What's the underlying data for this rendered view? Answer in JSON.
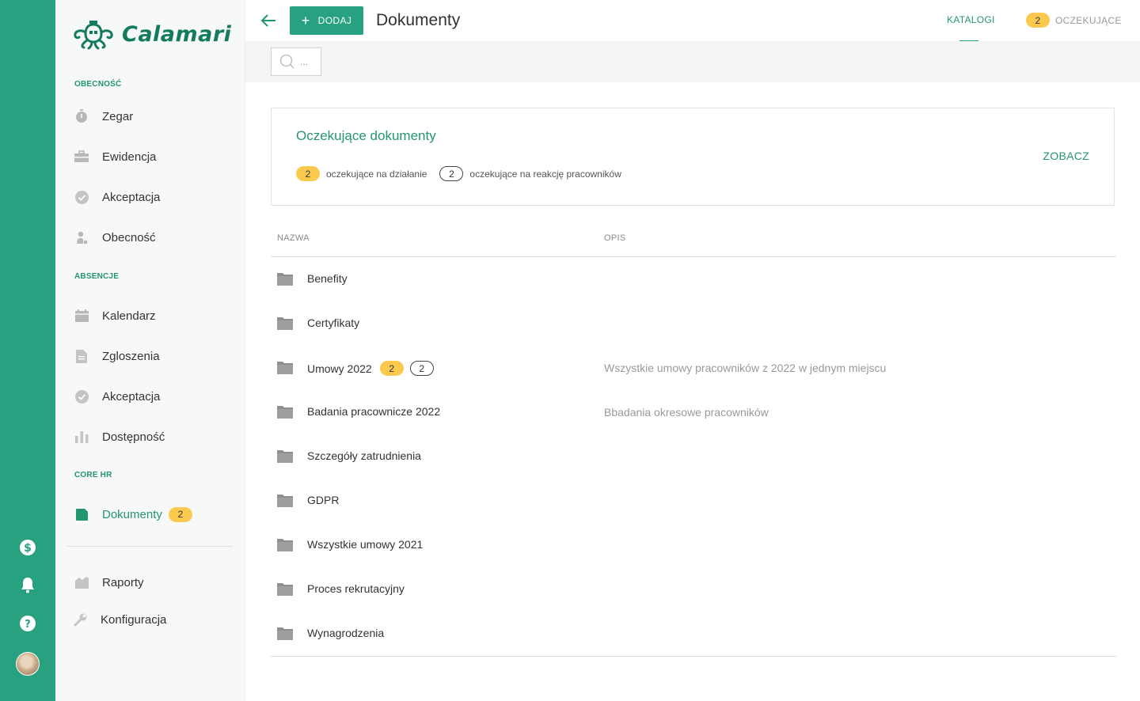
{
  "app": {
    "logo_text": "Calamari"
  },
  "colors": {
    "brand": "#27a17f",
    "brand_text": "#23956f",
    "badge": "#fcc94f"
  },
  "sidebar": {
    "sections": [
      {
        "label": "OBECNOŚĆ"
      },
      {
        "label": "ABSENCJE"
      },
      {
        "label": "CORE HR"
      }
    ],
    "items": [
      {
        "label": "Zegar",
        "icon": "stopwatch-icon"
      },
      {
        "label": "Ewidencja",
        "icon": "briefcase-icon"
      },
      {
        "label": "Akceptacja",
        "icon": "check-circle-icon"
      },
      {
        "label": "Obecność",
        "icon": "person-icon"
      },
      {
        "label": "Kalendarz",
        "icon": "calendar-icon"
      },
      {
        "label": "Zgloszenia",
        "icon": "document-icon"
      },
      {
        "label": "Akceptacja",
        "icon": "check-circle-icon"
      },
      {
        "label": "Dostępność",
        "icon": "bar-chart-icon"
      },
      {
        "label": "Dokumenty",
        "icon": "file-icon",
        "badge": "2",
        "active": true
      },
      {
        "label": "Raporty",
        "icon": "report-icon"
      },
      {
        "label": "Konfiguracja",
        "icon": "wrench-icon"
      }
    ]
  },
  "rail": {
    "icons": [
      "dollar-icon",
      "bell-icon",
      "help-icon",
      "avatar"
    ]
  },
  "header": {
    "add_label": "DODAJ",
    "title": "Dokumenty",
    "tabs": [
      {
        "label": "KATALOGI",
        "active": true
      },
      {
        "label": "OCZEKUJĄCE",
        "badge": "2"
      }
    ]
  },
  "search": {
    "placeholder": "..."
  },
  "pending": {
    "title": "Oczekujące dokumenty",
    "action_count": "2",
    "action_text": "oczekujące na działanie",
    "reaction_count": "2",
    "reaction_text": "oczekujące na reakcję pracowników",
    "link": "ZOBACZ"
  },
  "table": {
    "col_name": "NAZWA",
    "col_desc": "OPIS",
    "rows": [
      {
        "name": "Benefity",
        "desc": ""
      },
      {
        "name": "Certyfikaty",
        "desc": ""
      },
      {
        "name": "Umowy 2022",
        "desc": "Wszystkie umowy pracowników z 2022 w jednym miejscu",
        "badge1": "2",
        "badge2": "2"
      },
      {
        "name": "Badania pracownicze 2022",
        "desc": "Bbadania okresowe pracowników"
      },
      {
        "name": "Szczegóły zatrudnienia",
        "desc": ""
      },
      {
        "name": "GDPR",
        "desc": ""
      },
      {
        "name": "Wszystkie umowy 2021",
        "desc": ""
      },
      {
        "name": "Proces rekrutacyjny",
        "desc": ""
      },
      {
        "name": "Wynagrodzenia",
        "desc": ""
      }
    ]
  }
}
